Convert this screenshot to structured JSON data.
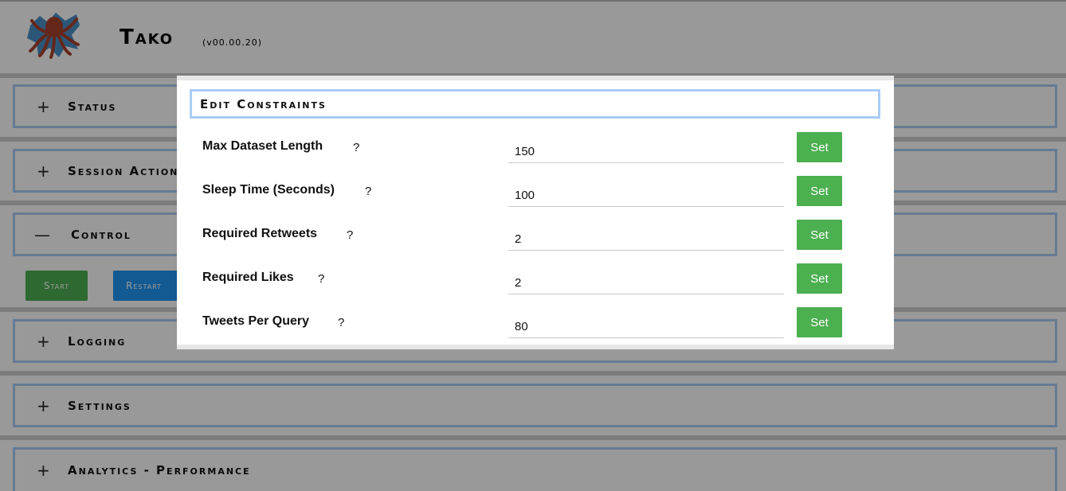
{
  "header": {
    "app_name": "Tako",
    "version": "(v00.00.20)",
    "logo_icon": "octopus-logo-icon"
  },
  "sections": [
    {
      "sign": "+",
      "title": "Status"
    },
    {
      "sign": "+",
      "title": "Session Actions"
    },
    {
      "sign": "—",
      "title": "Control"
    },
    {
      "sign": "+",
      "title": "Logging"
    },
    {
      "sign": "+",
      "title": "Settings"
    },
    {
      "sign": "+",
      "title": "Analytics - Performance"
    }
  ],
  "control": {
    "start_label": "Start",
    "restart_label": "Restart"
  },
  "modal": {
    "title": "Edit Constraints",
    "help_mark": "?",
    "set_label": "Set",
    "rows": [
      {
        "label": "Max Dataset Length",
        "value": "150"
      },
      {
        "label": "Sleep Time (Seconds)",
        "value": "100"
      },
      {
        "label": "Required Retweets",
        "value": "2"
      },
      {
        "label": "Required Likes",
        "value": "2"
      },
      {
        "label": "Tweets Per Query",
        "value": "80"
      }
    ]
  },
  "colors": {
    "accent_border": "#a9cdf6",
    "button_green": "#4caf50",
    "button_blue": "#2196f3"
  }
}
